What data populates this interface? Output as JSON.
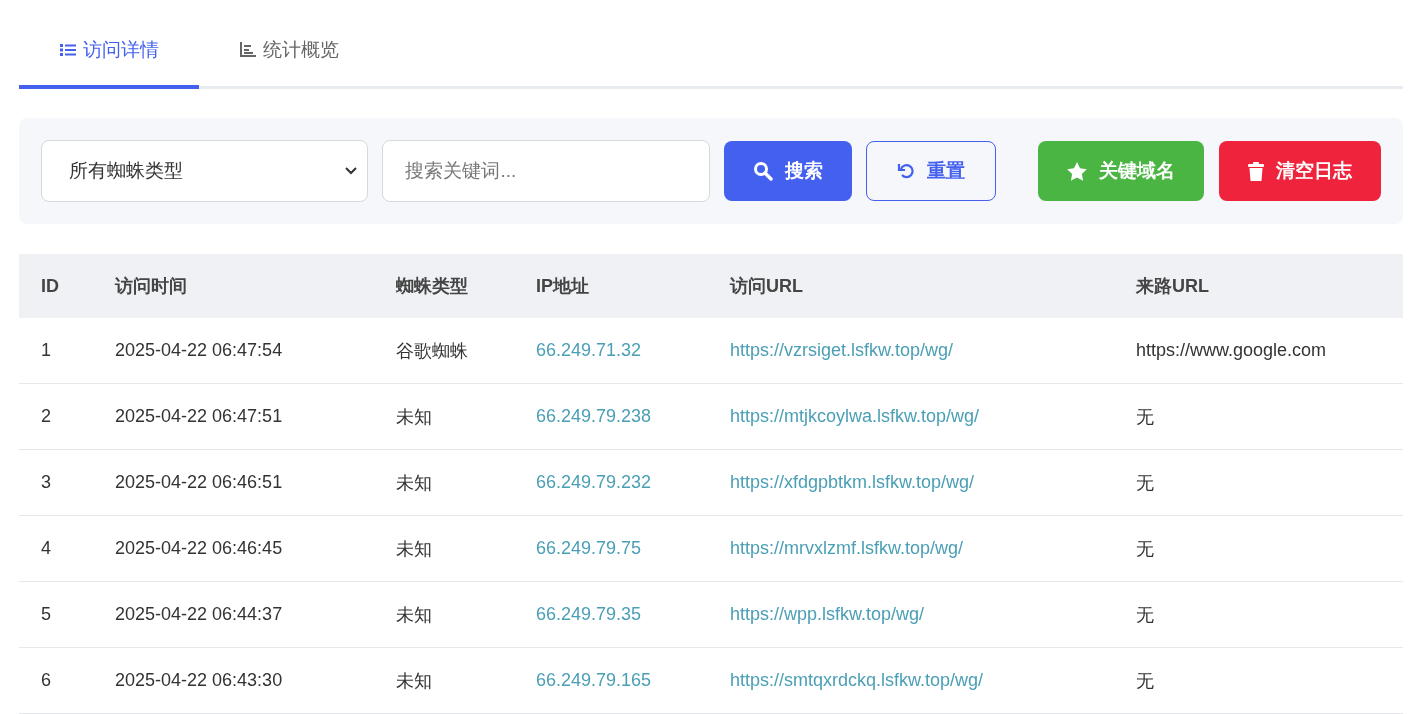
{
  "tabs": [
    {
      "label": "访问详情",
      "kind": "list",
      "selected": true
    },
    {
      "label": "统计概览",
      "kind": "chart",
      "selected": false
    }
  ],
  "filters": {
    "spider_select": {
      "value": "所有蜘蛛类型"
    },
    "search": {
      "placeholder": "搜索关键词..."
    },
    "buttons": [
      {
        "label": "搜索",
        "kind": "search"
      },
      {
        "label": "重置",
        "kind": "reset"
      },
      {
        "label": "关键域名",
        "kind": "keyword"
      },
      {
        "label": "清空日志",
        "kind": "clear"
      }
    ]
  },
  "table": {
    "columns": [
      "ID",
      "访问时间",
      "蜘蛛类型",
      "IP地址",
      "访问URL",
      "来路URL"
    ],
    "rows": [
      {
        "id": "1",
        "time": "2025-04-22 06:47:54",
        "spider": "谷歌蜘蛛",
        "ip": "66.249.71.32",
        "url": "https://vzrsiget.lsfkw.top/wg/",
        "referrer": "https://www.google.com"
      },
      {
        "id": "2",
        "time": "2025-04-22 06:47:51",
        "spider": "未知",
        "ip": "66.249.79.238",
        "url": "https://mtjkcoylwa.lsfkw.top/wg/",
        "referrer": "无"
      },
      {
        "id": "3",
        "time": "2025-04-22 06:46:51",
        "spider": "未知",
        "ip": "66.249.79.232",
        "url": "https://xfdgpbtkm.lsfkw.top/wg/",
        "referrer": "无"
      },
      {
        "id": "4",
        "time": "2025-04-22 06:46:45",
        "spider": "未知",
        "ip": "66.249.79.75",
        "url": "https://mrvxlzmf.lsfkw.top/wg/",
        "referrer": "无"
      },
      {
        "id": "5",
        "time": "2025-04-22 06:44:37",
        "spider": "未知",
        "ip": "66.249.79.35",
        "url": "https://wpp.lsfkw.top/wg/",
        "referrer": "无"
      },
      {
        "id": "6",
        "time": "2025-04-22 06:43:30",
        "spider": "未知",
        "ip": "66.249.79.165",
        "url": "https://smtqxrdckq.lsfkw.top/wg/",
        "referrer": "无"
      }
    ]
  }
}
